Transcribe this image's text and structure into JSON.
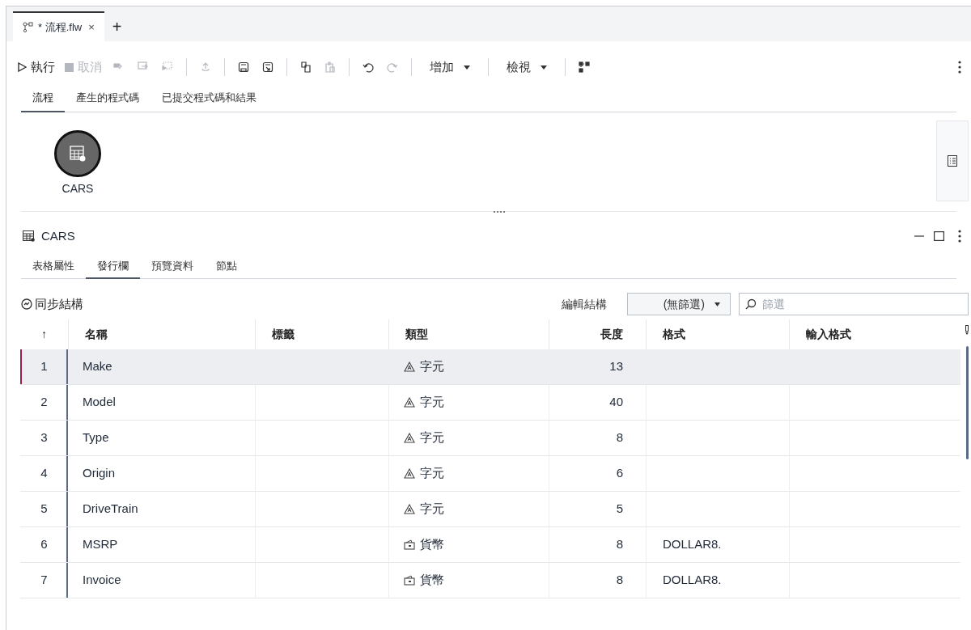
{
  "file_tabs": [
    {
      "label": "* 流程.flw",
      "selected": true,
      "close": "×"
    }
  ],
  "new_tab": "+",
  "toolbar": [
    {
      "kind": "button",
      "label": "執行",
      "disabled": false
    },
    {
      "kind": "button",
      "label": "取消",
      "disabled": true
    },
    {
      "kind": "icon",
      "disabled": true
    },
    {
      "kind": "icon",
      "disabled": true
    },
    {
      "kind": "icon",
      "disabled": true
    },
    {
      "kind": "separator"
    },
    {
      "kind": "icon",
      "disabled": true
    },
    {
      "kind": "separator"
    },
    {
      "kind": "icon",
      "disabled": false
    },
    {
      "kind": "icon",
      "disabled": false
    },
    {
      "kind": "separator"
    },
    {
      "kind": "icon",
      "disabled": false
    },
    {
      "kind": "icon",
      "disabled": true
    },
    {
      "kind": "separator"
    },
    {
      "kind": "icon",
      "disabled": false
    },
    {
      "kind": "icon",
      "disabled": true
    },
    {
      "kind": "separator"
    },
    {
      "kind": "menu",
      "label": "增加",
      "disabled": false
    },
    {
      "kind": "separator"
    },
    {
      "kind": "menu",
      "label": "檢視",
      "disabled": false
    },
    {
      "kind": "separator"
    },
    {
      "kind": "icon",
      "disabled": false
    }
  ],
  "view_tabs": [
    {
      "label": "流程",
      "selected": true
    },
    {
      "label": "產生的程式碼",
      "selected": false
    },
    {
      "label": "已提交程式碼和結果",
      "selected": false
    }
  ],
  "canvas": {
    "nodes": [
      {
        "label": "CARS",
        "selected": true
      }
    ]
  },
  "details": {
    "title": "CARS",
    "tabs": [
      {
        "label": "表格屬性",
        "selected": false
      },
      {
        "label": "發行欄",
        "selected": true
      },
      {
        "label": "預覽資料",
        "selected": false
      },
      {
        "label": "節點",
        "selected": false
      }
    ],
    "sync_button": "同步結構",
    "edit_label": "編輯結構",
    "filter_select": "(無篩選)",
    "filter_search": {
      "placeholder": "篩選"
    },
    "table": {
      "columns": [
        {
          "label": "↑",
          "kind": "index"
        },
        {
          "label": "名稱",
          "kind": "text"
        },
        {
          "label": "標籤",
          "kind": "text"
        },
        {
          "label": "類型",
          "kind": "text"
        },
        {
          "label": "長度",
          "kind": "number"
        },
        {
          "label": "格式",
          "kind": "text"
        },
        {
          "label": "輸入格式",
          "kind": "text"
        }
      ],
      "rows": [
        {
          "index": "1",
          "name": "Make",
          "type": "字元",
          "kind": "character",
          "length": "13",
          "selected": true
        },
        {
          "index": "2",
          "name": "Model",
          "type": "字元",
          "kind": "character",
          "length": "40",
          "selected": false
        },
        {
          "index": "3",
          "name": "Type",
          "type": "字元",
          "kind": "character",
          "length": "8",
          "selected": false
        },
        {
          "index": "4",
          "name": "Origin",
          "type": "字元",
          "kind": "character",
          "length": "6",
          "selected": false
        },
        {
          "index": "5",
          "name": "DriveTrain",
          "type": "字元",
          "kind": "character",
          "length": "5",
          "selected": false
        },
        {
          "index": "6",
          "name": "MSRP",
          "type": "貨幣",
          "kind": "currency",
          "length": "8",
          "format": "DOLLAR8.",
          "selected": false
        },
        {
          "index": "7",
          "name": "Invoice",
          "type": "貨幣",
          "kind": "currency",
          "length": "8",
          "format": "DOLLAR8.",
          "selected": false
        }
      ]
    }
  }
}
